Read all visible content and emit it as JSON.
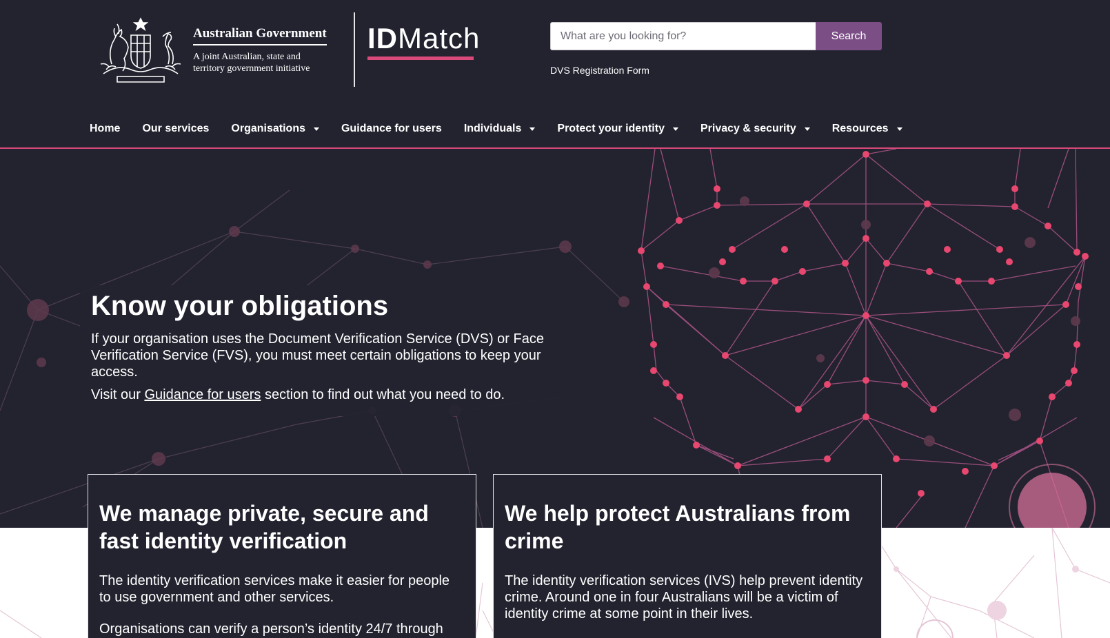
{
  "colors": {
    "background_dark": "#22232f",
    "accent_pink": "#d9497a",
    "search_button": "#7b4f86",
    "white": "#ffffff"
  },
  "header": {
    "gov_name": "Australian Government",
    "gov_sub": "A joint Australian, state and territory government initiative",
    "brand_bold": "ID",
    "brand_rest": "Match",
    "search": {
      "placeholder": "What are you looking for?",
      "value": "",
      "button_label": "Search"
    },
    "quick_link": "DVS Registration Form"
  },
  "nav": {
    "items": [
      {
        "label": "Home",
        "dropdown": false
      },
      {
        "label": "Our services",
        "dropdown": false
      },
      {
        "label": "Organisations",
        "dropdown": true
      },
      {
        "label": "Guidance for users",
        "dropdown": false
      },
      {
        "label": "Individuals",
        "dropdown": true
      },
      {
        "label": "Protect your identity",
        "dropdown": true
      },
      {
        "label": "Privacy & security",
        "dropdown": true
      },
      {
        "label": "Resources",
        "dropdown": true
      }
    ]
  },
  "hero": {
    "title": "Know your obligations",
    "paragraph": "If your organisation uses the Document Verification Service (DVS) or Face Verification Service (FVS), you must meet certain obligations to keep your access.",
    "visit_prefix": "Visit our ",
    "visit_link": "Guidance for users",
    "visit_suffix": " section to find out what you need to do."
  },
  "cards": [
    {
      "title": "We manage private, secure and fast identity verification",
      "text": "The identity verification services make it easier for people to use government and other services.",
      "text2": "Organisations can verify a person’s identity 24/7 through"
    },
    {
      "title": "We help protect Australians from crime",
      "text": "The identity verification services (IVS) help prevent identity crime. Around one in four Australians will be a victim of identity crime at some point in their lives.",
      "text2": ""
    }
  ],
  "icons": {
    "crest": "coat-of-arms-icon",
    "caret": "caret-down-icon"
  }
}
